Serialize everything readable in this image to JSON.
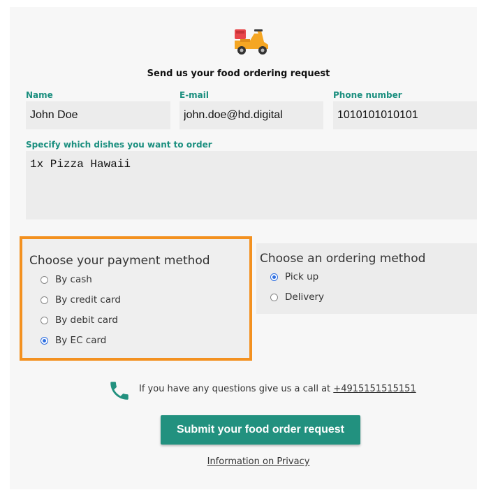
{
  "form": {
    "title": "Send us your food ordering request",
    "name_label": "Name",
    "name_value": "John Doe",
    "email_label": "E-mail",
    "email_value": "john.doe@hd.digital",
    "phone_label": "Phone number",
    "phone_value": "1010101010101",
    "dishes_label": "Specify which dishes you want to order",
    "dishes_value": "1x Pizza Hawaii"
  },
  "payment": {
    "title": "Choose your payment method",
    "options": [
      {
        "label": "By cash",
        "selected": false
      },
      {
        "label": "By credit card",
        "selected": false
      },
      {
        "label": "By debit card",
        "selected": false
      },
      {
        "label": "By EC card",
        "selected": true
      }
    ]
  },
  "ordering": {
    "title": "Choose an ordering method",
    "options": [
      {
        "label": "Pick up",
        "selected": true
      },
      {
        "label": "Delivery",
        "selected": false
      }
    ]
  },
  "contact": {
    "text": "If you have any questions give us a call at",
    "phone": "+4915151515151"
  },
  "submit_label": "Submit your food order request",
  "privacy_label": "Information on Privacy",
  "colors": {
    "accent": "#22917f",
    "highlight": "#f39120",
    "radio_selected": "#2f6fe0"
  }
}
